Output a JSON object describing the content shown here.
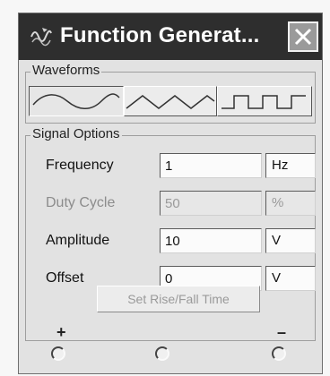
{
  "window": {
    "title": "Function Generat..."
  },
  "waveforms": {
    "legend": "Waveforms",
    "buttons": [
      {
        "name": "sine",
        "selected": true
      },
      {
        "name": "triangle",
        "selected": false
      },
      {
        "name": "square",
        "selected": false
      }
    ]
  },
  "signal_options": {
    "legend": "Signal Options",
    "frequency": {
      "label": "Frequency",
      "value": "1",
      "unit": "Hz"
    },
    "duty_cycle": {
      "label": "Duty Cycle",
      "value": "50",
      "unit": "%"
    },
    "amplitude": {
      "label": "Amplitude",
      "value": "10",
      "unit": "V"
    },
    "offset": {
      "label": "Offset",
      "value": "0",
      "unit": "V"
    },
    "rise_fall_button": "Set Rise/Fall Time"
  },
  "terminals": {
    "plus": "+",
    "minus": "–"
  }
}
